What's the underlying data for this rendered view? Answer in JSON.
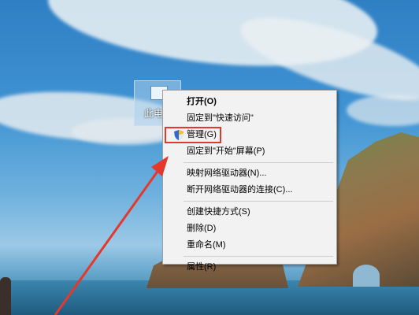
{
  "desktop": {
    "icon_label": "此电脑"
  },
  "context_menu": {
    "items": [
      {
        "label": "打开(O)",
        "bold": true
      },
      {
        "label": "固定到\"快速访问\""
      },
      {
        "label": "管理(G)",
        "icon": "admin-shield-icon",
        "highlighted": true
      },
      {
        "label": "固定到\"开始\"屏幕(P)"
      },
      {
        "label": "映射网络驱动器(N)..."
      },
      {
        "label": "断开网络驱动器的连接(C)..."
      },
      {
        "label": "创建快捷方式(S)"
      },
      {
        "label": "删除(D)"
      },
      {
        "label": "重命名(M)"
      },
      {
        "label": "属性(R)"
      }
    ]
  },
  "annotation": {
    "highlight_color": "#e3392c",
    "arrow_color": "#e3392c"
  }
}
